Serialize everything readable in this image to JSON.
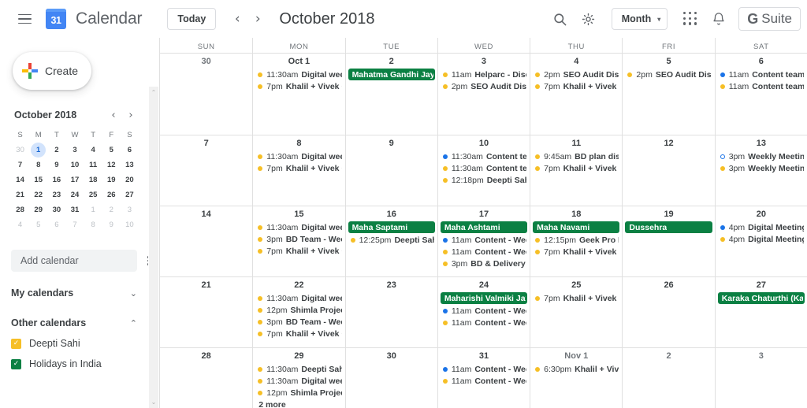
{
  "topbar": {
    "menu_icon": "hamburger-icon",
    "logo_day": "31",
    "app_title": "Calendar",
    "today_label": "Today",
    "prev_label": "‹",
    "next_label": "›",
    "month_title": "October 2018",
    "search_icon": "search-icon",
    "settings_icon": "gear-icon",
    "view_label": "Month",
    "view_caret": "▾",
    "apps_icon": "apps-grid-icon",
    "notifications_icon": "bell-icon",
    "gsuite_g": "G",
    "gsuite_label": "Suite"
  },
  "sidebar": {
    "create_label": "Create",
    "create_icon": "plus-icon",
    "mini_calendar": {
      "title": "October 2018",
      "prev": "‹",
      "next": "›",
      "dow": [
        "S",
        "M",
        "T",
        "W",
        "T",
        "F",
        "S"
      ],
      "weeks": [
        [
          {
            "d": "30",
            "t": "oth"
          },
          {
            "d": "1",
            "t": "sel"
          },
          {
            "d": "2",
            "t": "cur"
          },
          {
            "d": "3",
            "t": "cur"
          },
          {
            "d": "4",
            "t": "cur"
          },
          {
            "d": "5",
            "t": "cur"
          },
          {
            "d": "6",
            "t": "cur"
          }
        ],
        [
          {
            "d": "7",
            "t": "cur"
          },
          {
            "d": "8",
            "t": "cur"
          },
          {
            "d": "9",
            "t": "cur"
          },
          {
            "d": "10",
            "t": "cur"
          },
          {
            "d": "11",
            "t": "cur"
          },
          {
            "d": "12",
            "t": "cur"
          },
          {
            "d": "13",
            "t": "cur"
          }
        ],
        [
          {
            "d": "14",
            "t": "cur"
          },
          {
            "d": "15",
            "t": "cur"
          },
          {
            "d": "16",
            "t": "cur"
          },
          {
            "d": "17",
            "t": "cur"
          },
          {
            "d": "18",
            "t": "cur"
          },
          {
            "d": "19",
            "t": "cur"
          },
          {
            "d": "20",
            "t": "cur"
          }
        ],
        [
          {
            "d": "21",
            "t": "cur"
          },
          {
            "d": "22",
            "t": "cur"
          },
          {
            "d": "23",
            "t": "cur"
          },
          {
            "d": "24",
            "t": "cur"
          },
          {
            "d": "25",
            "t": "cur"
          },
          {
            "d": "26",
            "t": "cur"
          },
          {
            "d": "27",
            "t": "cur"
          }
        ],
        [
          {
            "d": "28",
            "t": "cur"
          },
          {
            "d": "29",
            "t": "cur"
          },
          {
            "d": "30",
            "t": "cur"
          },
          {
            "d": "31",
            "t": "cur"
          },
          {
            "d": "1",
            "t": "oth"
          },
          {
            "d": "2",
            "t": "oth"
          },
          {
            "d": "3",
            "t": "oth"
          }
        ],
        [
          {
            "d": "4",
            "t": "oth"
          },
          {
            "d": "5",
            "t": "oth"
          },
          {
            "d": "6",
            "t": "oth"
          },
          {
            "d": "7",
            "t": "oth"
          },
          {
            "d": "8",
            "t": "oth"
          },
          {
            "d": "9",
            "t": "oth"
          },
          {
            "d": "10",
            "t": "oth"
          }
        ]
      ]
    },
    "add_calendar_placeholder": "Add calendar",
    "add_calendar_value": "",
    "overflow_icon": "kebab-menu-icon",
    "my_calendars_label": "My calendars",
    "my_calendars_chevron": "⌄",
    "other_calendars_label": "Other calendars",
    "other_calendars_chevron": "⌃",
    "other_calendars": [
      {
        "label": "Deepti Sahi",
        "color": "#f6bf26",
        "checked": true,
        "check": "✓"
      },
      {
        "label": "Holidays in India",
        "color": "#0b8043",
        "checked": true,
        "check": "✓"
      }
    ]
  },
  "scrollbar": {
    "up_arrow": "⌃",
    "down_arrow": "⌄"
  },
  "calendar": {
    "day_headers": [
      "SUN",
      "MON",
      "TUE",
      "WED",
      "THU",
      "FRI",
      "SAT"
    ],
    "colors": {
      "yellow": "#f6bf26",
      "blue": "#1a73e8",
      "green": "#0b8043"
    },
    "weeks": [
      {
        "days": [
          {
            "num": "30",
            "muted": true,
            "events": []
          },
          {
            "num": "Oct 1",
            "muted": false,
            "events": [
              {
                "kind": "dot",
                "color": "#f6bf26",
                "time": "11:30am",
                "name": "Digital weekl"
              },
              {
                "kind": "dot",
                "color": "#f6bf26",
                "time": "7pm",
                "name": "Khalil + Vivek + D"
              }
            ]
          },
          {
            "num": "2",
            "muted": false,
            "events": [
              {
                "kind": "chip",
                "color": "#0b8043",
                "name": "Mahatma Gandhi Jayant"
              }
            ]
          },
          {
            "num": "3",
            "muted": false,
            "events": [
              {
                "kind": "dot",
                "color": "#f6bf26",
                "time": "11am",
                "name": "Helparc - Discu"
              },
              {
                "kind": "dot",
                "color": "#f6bf26",
                "time": "2pm",
                "name": "SEO Audit Discu"
              }
            ]
          },
          {
            "num": "4",
            "muted": false,
            "events": [
              {
                "kind": "dot",
                "color": "#f6bf26",
                "time": "2pm",
                "name": "SEO Audit Discu"
              },
              {
                "kind": "dot",
                "color": "#f6bf26",
                "time": "7pm",
                "name": "Khalil + Vivek + D"
              }
            ]
          },
          {
            "num": "5",
            "muted": false,
            "events": [
              {
                "kind": "dot",
                "color": "#f6bf26",
                "time": "2pm",
                "name": "SEO Audit Discus"
              }
            ]
          },
          {
            "num": "6",
            "muted": false,
            "events": [
              {
                "kind": "dot",
                "color": "#1a73e8",
                "time": "11am",
                "name": "Content team re"
              },
              {
                "kind": "dot",
                "color": "#f6bf26",
                "time": "11am",
                "name": "Content team re"
              }
            ]
          }
        ]
      },
      {
        "days": [
          {
            "num": "7",
            "muted": false,
            "events": []
          },
          {
            "num": "8",
            "muted": false,
            "events": [
              {
                "kind": "dot",
                "color": "#f6bf26",
                "time": "11:30am",
                "name": "Digital weekl"
              },
              {
                "kind": "dot",
                "color": "#f6bf26",
                "time": "7pm",
                "name": "Khalil + Vivek + D"
              }
            ]
          },
          {
            "num": "9",
            "muted": false,
            "events": []
          },
          {
            "num": "10",
            "muted": false,
            "events": [
              {
                "kind": "dot",
                "color": "#1a73e8",
                "time": "11:30am",
                "name": "Content tear"
              },
              {
                "kind": "dot",
                "color": "#f6bf26",
                "time": "11:30am",
                "name": "Content tear"
              },
              {
                "kind": "dot",
                "color": "#f6bf26",
                "time": "12:18pm",
                "name": "Deepti Sahi's"
              }
            ]
          },
          {
            "num": "11",
            "muted": false,
            "events": [
              {
                "kind": "dot",
                "color": "#f6bf26",
                "time": "9:45am",
                "name": "BD plan discu"
              },
              {
                "kind": "dot",
                "color": "#f6bf26",
                "time": "7pm",
                "name": "Khalil + Vivek + D"
              }
            ]
          },
          {
            "num": "12",
            "muted": false,
            "events": []
          },
          {
            "num": "13",
            "muted": false,
            "events": [
              {
                "kind": "dot",
                "color": "#1a73e8",
                "hollow": true,
                "time": "3pm",
                "name": "Weekly Meeting"
              },
              {
                "kind": "dot",
                "color": "#f6bf26",
                "time": "3pm",
                "name": "Weekly Meeting"
              }
            ]
          }
        ]
      },
      {
        "days": [
          {
            "num": "14",
            "muted": false,
            "events": []
          },
          {
            "num": "15",
            "muted": false,
            "events": [
              {
                "kind": "dot",
                "color": "#f6bf26",
                "time": "11:30am",
                "name": "Digital weekl"
              },
              {
                "kind": "dot",
                "color": "#f6bf26",
                "time": "3pm",
                "name": "BD Team - Weekl"
              },
              {
                "kind": "dot",
                "color": "#f6bf26",
                "time": "7pm",
                "name": "Khalil + Vivek + D"
              }
            ]
          },
          {
            "num": "16",
            "muted": false,
            "events": [
              {
                "kind": "chip",
                "color": "#0b8043",
                "name": "Maha Saptami"
              },
              {
                "kind": "dot",
                "color": "#f6bf26",
                "time": "12:25pm",
                "name": "Deepti Sahi's"
              }
            ]
          },
          {
            "num": "17",
            "muted": false,
            "events": [
              {
                "kind": "chip",
                "color": "#0b8043",
                "name": "Maha Ashtami"
              },
              {
                "kind": "dot",
                "color": "#1a73e8",
                "time": "11am",
                "name": "Content - Week"
              },
              {
                "kind": "dot",
                "color": "#f6bf26",
                "time": "11am",
                "name": "Content - Week"
              },
              {
                "kind": "dot",
                "color": "#f6bf26",
                "time": "3pm",
                "name": "BD & Delivery Te"
              }
            ]
          },
          {
            "num": "18",
            "muted": false,
            "events": [
              {
                "kind": "chip",
                "color": "#0b8043",
                "name": "Maha Navami"
              },
              {
                "kind": "dot",
                "color": "#f6bf26",
                "time": "12:15pm",
                "name": "Geek Pro Pr"
              },
              {
                "kind": "dot",
                "color": "#f6bf26",
                "time": "7pm",
                "name": "Khalil + Vivek + D"
              }
            ]
          },
          {
            "num": "19",
            "muted": false,
            "events": [
              {
                "kind": "chip",
                "color": "#0b8043",
                "name": "Dussehra"
              }
            ]
          },
          {
            "num": "20",
            "muted": false,
            "events": [
              {
                "kind": "dot",
                "color": "#1a73e8",
                "time": "4pm",
                "name": "Digital Meeting"
              },
              {
                "kind": "dot",
                "color": "#f6bf26",
                "time": "4pm",
                "name": "Digital Meeting"
              }
            ]
          }
        ]
      },
      {
        "days": [
          {
            "num": "21",
            "muted": false,
            "events": []
          },
          {
            "num": "22",
            "muted": false,
            "events": [
              {
                "kind": "dot",
                "color": "#f6bf26",
                "time": "11:30am",
                "name": "Digital weekl"
              },
              {
                "kind": "dot",
                "color": "#f6bf26",
                "time": "12pm",
                "name": "Shimla Projects"
              },
              {
                "kind": "dot",
                "color": "#f6bf26",
                "time": "3pm",
                "name": "BD Team - Weekl"
              },
              {
                "kind": "dot",
                "color": "#f6bf26",
                "time": "7pm",
                "name": "Khalil + Vivek + D"
              }
            ]
          },
          {
            "num": "23",
            "muted": false,
            "events": []
          },
          {
            "num": "24",
            "muted": false,
            "events": [
              {
                "kind": "chip",
                "color": "#0b8043",
                "name": "Maharishi Valmiki Jayan"
              },
              {
                "kind": "dot",
                "color": "#1a73e8",
                "time": "11am",
                "name": "Content - Week"
              },
              {
                "kind": "dot",
                "color": "#f6bf26",
                "time": "11am",
                "name": "Content - Week"
              }
            ]
          },
          {
            "num": "25",
            "muted": false,
            "events": [
              {
                "kind": "dot",
                "color": "#f6bf26",
                "time": "7pm",
                "name": "Khalil + Vivek + D"
              }
            ]
          },
          {
            "num": "26",
            "muted": false,
            "events": []
          },
          {
            "num": "27",
            "muted": false,
            "events": [
              {
                "kind": "chip",
                "color": "#0b8043",
                "name": "Karaka Chaturthi (Karva"
              }
            ]
          }
        ]
      },
      {
        "days": [
          {
            "num": "28",
            "muted": false,
            "events": []
          },
          {
            "num": "29",
            "muted": false,
            "events": [
              {
                "kind": "dot",
                "color": "#f6bf26",
                "time": "11:30am",
                "name": "Deepti Sahi's"
              },
              {
                "kind": "dot",
                "color": "#f6bf26",
                "time": "11:30am",
                "name": "Digital weekl"
              },
              {
                "kind": "dot",
                "color": "#f6bf26",
                "time": "12pm",
                "name": "Shimla Projects"
              }
            ],
            "more": "2 more"
          },
          {
            "num": "30",
            "muted": false,
            "events": []
          },
          {
            "num": "31",
            "muted": false,
            "events": [
              {
                "kind": "dot",
                "color": "#1a73e8",
                "time": "11am",
                "name": "Content - Week"
              },
              {
                "kind": "dot",
                "color": "#f6bf26",
                "time": "11am",
                "name": "Content - Week"
              }
            ]
          },
          {
            "num": "Nov 1",
            "muted": true,
            "events": [
              {
                "kind": "dot",
                "color": "#f6bf26",
                "time": "6:30pm",
                "name": "Khalil + Vivek"
              }
            ]
          },
          {
            "num": "2",
            "muted": true,
            "events": []
          },
          {
            "num": "3",
            "muted": true,
            "events": []
          }
        ]
      }
    ]
  }
}
